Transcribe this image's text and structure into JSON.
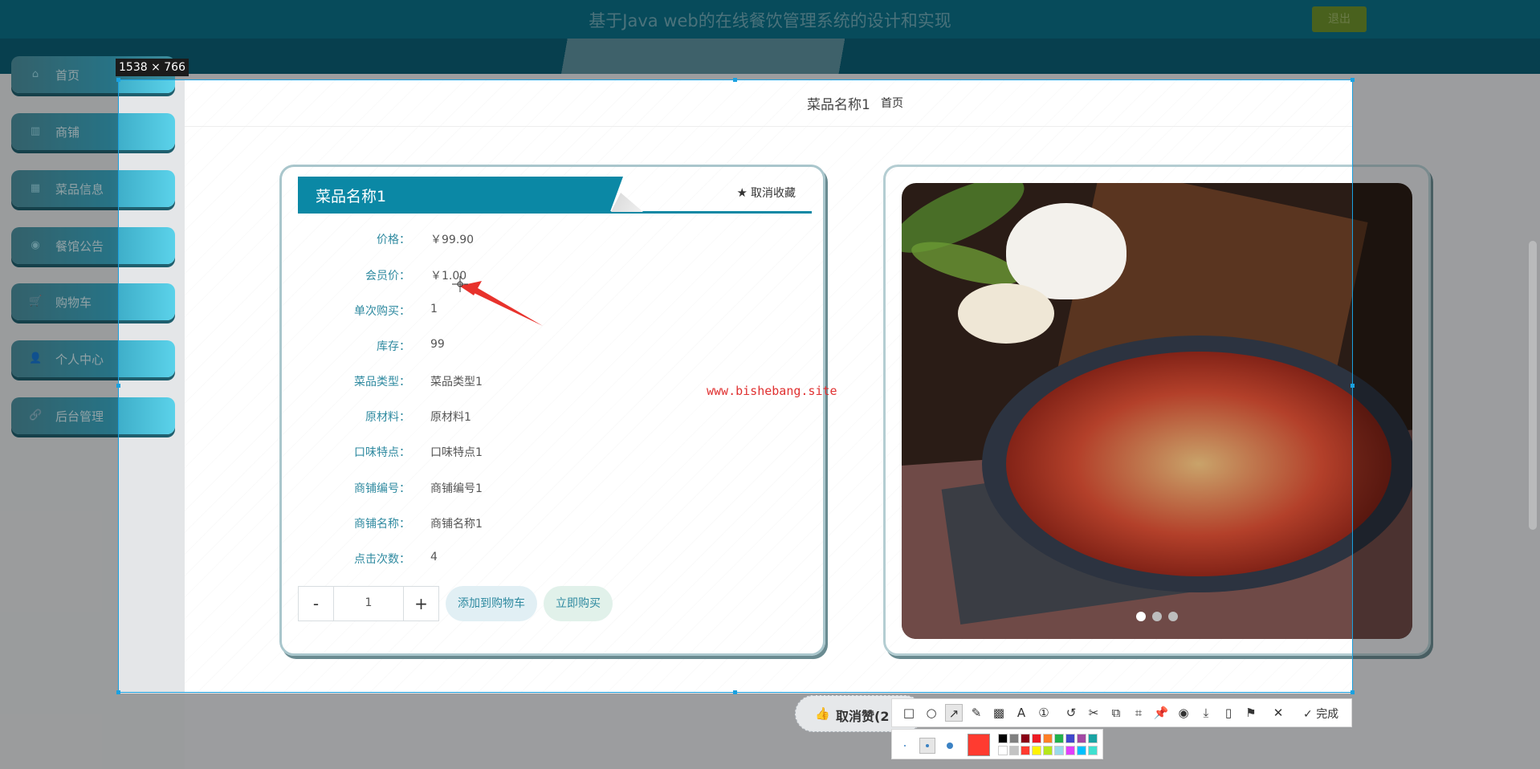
{
  "header": {
    "title": "基于Java web的在线餐饮管理系统的设计和实现",
    "logout_label": "退出"
  },
  "sidebar": {
    "items": [
      {
        "label": "首页",
        "icon": "home-icon",
        "glyph": "⌂"
      },
      {
        "label": "商铺",
        "icon": "bars-icon",
        "glyph": "▥"
      },
      {
        "label": "菜品信息",
        "icon": "grid-icon",
        "glyph": "▦"
      },
      {
        "label": "餐馆公告",
        "icon": "eye-icon",
        "glyph": "◉"
      },
      {
        "label": "购物车",
        "icon": "cart-icon",
        "glyph": "🛒"
      },
      {
        "label": "个人中心",
        "icon": "user-icon",
        "glyph": "👤"
      },
      {
        "label": "后台管理",
        "icon": "link-icon",
        "glyph": "🔗"
      }
    ]
  },
  "capture": {
    "size_label": "1538 × 766",
    "border_color": "#1aa1e0"
  },
  "breadcrumb": {
    "current": "菜品名称1",
    "home": "首页"
  },
  "product": {
    "name": "菜品名称1",
    "favorite_label": "取消收藏",
    "fields": [
      {
        "key": "价格：",
        "value": "￥99.90"
      },
      {
        "key": "会员价：",
        "value": "￥1.00"
      },
      {
        "key": "单次购买：",
        "value": "1"
      },
      {
        "key": "库存：",
        "value": "99"
      },
      {
        "key": "菜品类型：",
        "value": "菜品类型1"
      },
      {
        "key": "原材料：",
        "value": "原材料1"
      },
      {
        "key": "口味特点：",
        "value": "口味特点1"
      },
      {
        "key": "商铺编号：",
        "value": "商铺编号1"
      },
      {
        "key": "商铺名称：",
        "value": "商铺名称1"
      },
      {
        "key": "点击次数：",
        "value": "4"
      }
    ],
    "quantity": "1",
    "minus": "-",
    "plus": "+",
    "add_to_cart": "添加到购物车",
    "buy_now": "立即购买",
    "carousel_active": 1,
    "carousel_count": 3
  },
  "watermark": "www.bishebang.site",
  "like_button": {
    "label": "取消赞(2"
  },
  "toolbar": {
    "tools": [
      "rectangle-icon",
      "ellipse-icon",
      "arrow-icon",
      "pen-icon",
      "mosaic-icon",
      "text-icon",
      "number-icon",
      "undo-icon",
      "cut-icon",
      "copy-icon",
      "scan-icon",
      "pin-icon",
      "record-icon",
      "download-icon",
      "save-icon",
      "bookmark-icon",
      "close-icon"
    ],
    "done_label": "完成",
    "current_color": "#ff3b30",
    "swatches": [
      "#000000",
      "#7f7f7f",
      "#880015",
      "#ed1c24",
      "#ff7f27",
      "#22b14c",
      "#3f48cc",
      "#a349a4",
      "#1aa3a3",
      "#ffffff",
      "#c3c3c3",
      "#ff3b30",
      "#fff200",
      "#b5e61d",
      "#99d9ea",
      "#e040fb",
      "#00c0ff",
      "#40e0d0"
    ]
  }
}
